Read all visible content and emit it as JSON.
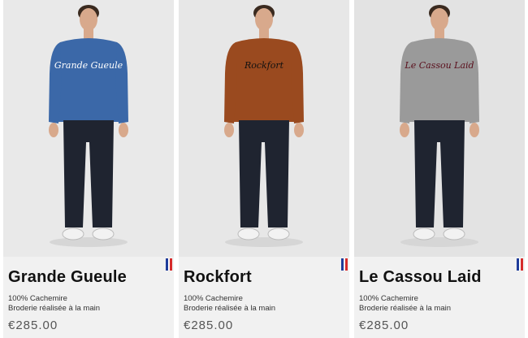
{
  "products": [
    {
      "name": "Grande Gueule",
      "description_line1": "100% Cachemire",
      "description_line2": "Broderie réalisée à la main",
      "price": "€285.00",
      "sweater_text": "Grande Gueule",
      "sweater_color": "#3b68a8",
      "text_color": "#ffffff",
      "photo_bg": "#e9e9e9",
      "origin_flag": "french-flag-icon"
    },
    {
      "name": "Rockfort",
      "description_line1": "100% Cachemire",
      "description_line2": "Broderie réalisée à la main",
      "price": "€285.00",
      "sweater_text": "Rockfort",
      "sweater_color": "#9a4a1f",
      "text_color": "#111111",
      "photo_bg": "#e7e7e7",
      "origin_flag": "french-flag-icon"
    },
    {
      "name": "Le Cassou Laid",
      "description_line1": "100% Cachemire",
      "description_line2": "Broderie réalisée à la main",
      "price": "€285.00",
      "sweater_text": "Le Cassou Laid",
      "sweater_color": "#9a9a9a",
      "text_color": "#5a0f1c",
      "photo_bg": "#e3e3e3",
      "origin_flag": "french-flag-icon"
    }
  ],
  "colors": {
    "flag_blue": "#1f3c9a",
    "flag_white": "#ffffff",
    "flag_red": "#d62b2b",
    "jeans": "#1f2430",
    "skin": "#d8a98c",
    "hair": "#3a2a1f",
    "shoe": "#f2f2f2"
  }
}
